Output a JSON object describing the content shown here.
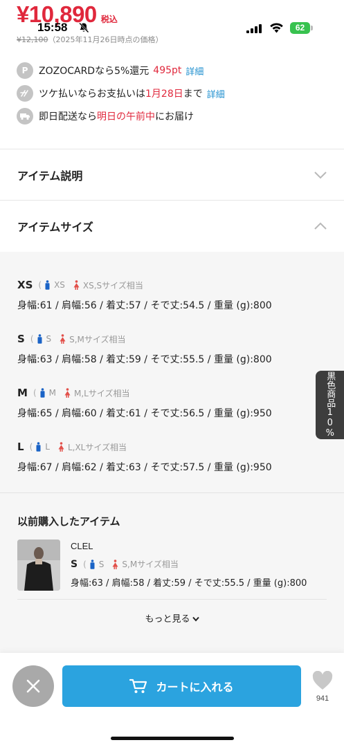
{
  "status_bar": {
    "time": "15:58",
    "battery": "62"
  },
  "price": {
    "current": "¥10,890",
    "tax_label": "税込",
    "original": "¥12,100",
    "note": "（2025年11月26日時点の価格）"
  },
  "benefits": [
    {
      "icon": "P",
      "text_a": "ZOZOCARDなら5%還元",
      "points": "495pt",
      "link": "詳細"
    },
    {
      "text_a": "ツケ払いならお支払いは",
      "highlight": "1月28日",
      "text_b": "まで",
      "link": "詳細"
    },
    {
      "text_a": "即日配送なら",
      "highlight": "明日の午前中",
      "text_b": "にお届け"
    }
  ],
  "sections": {
    "description": "アイテム説明",
    "size": "アイテムサイズ"
  },
  "sizes": [
    {
      "name": "XS",
      "male": "XS",
      "female": "XS,Sサイズ相当",
      "measures": "身幅:61 / 肩幅:56 / 着丈:57 / そで丈:54.5 / 重量 (g):800"
    },
    {
      "name": "S",
      "male": "S",
      "female": "S,Mサイズ相当",
      "measures": "身幅:63 / 肩幅:58 / 着丈:59 / そで丈:55.5 / 重量 (g):800"
    },
    {
      "name": "M",
      "male": "M",
      "female": "M,Lサイズ相当",
      "measures": "身幅:65 / 肩幅:60 / 着丈:61 / そで丈:56.5 / 重量 (g):950"
    },
    {
      "name": "L",
      "male": "L",
      "female": "L,XLサイズ相当",
      "measures": "身幅:67 / 肩幅:62 / 着丈:63 / そで丈:57.5 / 重量 (g):950"
    }
  ],
  "paren_open": "(",
  "previous": {
    "title": "以前購入したアイテム",
    "brand": "CLEL",
    "size": "S",
    "male": "S",
    "female": "S,Mサイズ相当",
    "measures": "身幅:63 / 肩幅:58 / 着丈:59 / そで丈:55.5 / 重量 (g):800",
    "more": "もっと見る"
  },
  "side_tab": "黒色商品10%",
  "bottom": {
    "cart_label": "カートに入れる",
    "fav_count": "941"
  },
  "colors": {
    "accent_red": "#e0283c",
    "link_blue": "#1f8fcf",
    "cart_blue": "#2ba3df",
    "battery_green": "#38c24f"
  }
}
